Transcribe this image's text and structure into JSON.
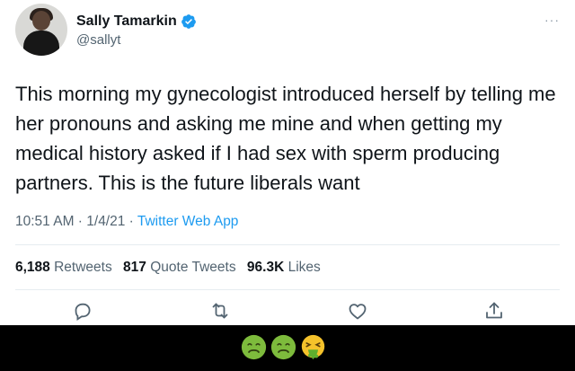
{
  "tweet": {
    "author_name": "Sally Tamarkin",
    "handle": "@sallyt",
    "more_label": "···",
    "text": "This morning my gynecologist introduced herself by telling me her pronouns and asking me mine and when getting my medical history asked if I had sex with sperm producing partners. This is the future liberals want",
    "timestamp": "10:51 AM · 1/4/21 · ",
    "source": "Twitter Web App",
    "stats": {
      "retweets_count": "6,188",
      "retweets_label": "Retweets",
      "quote_count": "817",
      "quote_label": "Quote Tweets",
      "likes_count": "96.3K",
      "likes_label": "Likes"
    }
  },
  "colors": {
    "link": "#1d9bf0",
    "secondary_text": "#536471",
    "bottom_bar": "#000000"
  },
  "actions": [
    "reply-icon",
    "retweet-icon",
    "like-icon",
    "share-icon"
  ],
  "footer_emojis": [
    "nauseated-face",
    "nauseated-face",
    "vomiting-face"
  ]
}
